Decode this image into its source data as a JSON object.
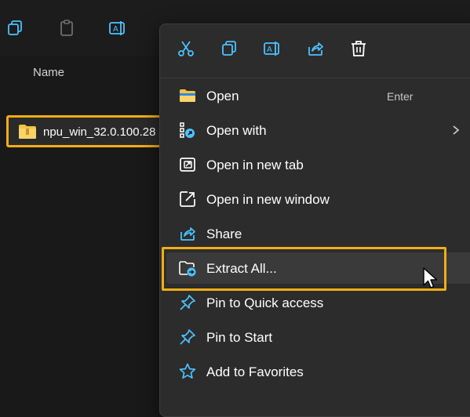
{
  "explorer": {
    "column_header": "Name",
    "file_name": "npu_win_32.0.100.28"
  },
  "context_menu": {
    "toolbar": [
      {
        "icon": "cut-icon"
      },
      {
        "icon": "copy-icon"
      },
      {
        "icon": "rename-icon"
      },
      {
        "icon": "share-icon"
      },
      {
        "icon": "delete-icon"
      }
    ],
    "items": [
      {
        "label": "Open",
        "accelerator": "Enter",
        "icon": "folder-icon"
      },
      {
        "label": "Open with",
        "icon": "open-with-icon"
      },
      {
        "label": "Open in new tab",
        "icon": "new-tab-icon"
      },
      {
        "label": "Open in new window",
        "icon": "new-window-icon"
      },
      {
        "label": "Share",
        "icon": "share-icon"
      },
      {
        "label": "Extract All...",
        "icon": "extract-icon"
      },
      {
        "label": "Pin to Quick access",
        "icon": "pin-icon"
      },
      {
        "label": "Pin to Start",
        "icon": "pin-icon"
      },
      {
        "label": "Add to Favorites",
        "icon": "star-icon"
      }
    ]
  },
  "colors": {
    "accent": "#4cc2ff",
    "highlight": "#f3ad16",
    "folder": "#f5c242",
    "menu_bg": "#2c2c2c"
  }
}
